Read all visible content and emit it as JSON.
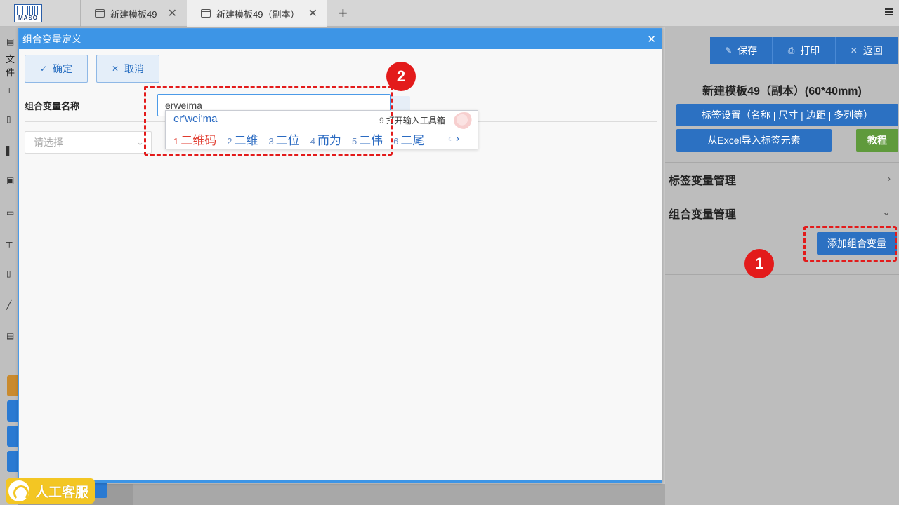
{
  "app": {
    "logo_text": "MASO",
    "tabs": [
      {
        "label": "新建模板49"
      },
      {
        "label": "新建模板49（副本）"
      }
    ],
    "add_tab_symbol": "+"
  },
  "left_sidebar": {
    "label_fragment": "文件"
  },
  "right_panel": {
    "buttons": {
      "save": "保存",
      "print": "打印",
      "back": "返回"
    },
    "template_title": "新建模板49（副本）(60*40mm)",
    "label_settings_button": "标签设置（名称 | 尺寸 | 边距 | 多列等）",
    "excel_import_button": "从Excel导入标签元素",
    "tutorial_button": "教程",
    "sections": [
      {
        "title": "标签变量管理",
        "expanded": false
      },
      {
        "title": "组合变量管理",
        "expanded": true
      }
    ],
    "add_combo_var_button": "添加组合变量"
  },
  "modal": {
    "title": "组合变量定义",
    "confirm_button": "确定",
    "cancel_button": "取消",
    "name_label": "组合变量名称",
    "name_input_value": "erweima",
    "select_placeholder": "请选择"
  },
  "ime": {
    "pinyin": "er'wei'ma",
    "toolbox": {
      "num": "9",
      "label": "打开输入工具箱"
    },
    "candidates": [
      {
        "num": "1",
        "text": "二维码",
        "selected": true
      },
      {
        "num": "2",
        "text": "二维",
        "selected": false
      },
      {
        "num": "3",
        "text": "二位",
        "selected": false
      },
      {
        "num": "4",
        "text": "而为",
        "selected": false
      },
      {
        "num": "5",
        "text": "二伟",
        "selected": false
      },
      {
        "num": "6",
        "text": "二尾",
        "selected": false
      }
    ]
  },
  "annotations": {
    "badge1": "1",
    "badge2": "2",
    "color": "#e31b1b"
  },
  "customer_service": {
    "label": "人工客服"
  },
  "colors": {
    "primary_blue": "#2c71c2",
    "modal_header": "#3d95e6",
    "tutorial_green": "#5f9a3c",
    "service_yellow": "#f3c623",
    "ime_selected": "#e03a2d"
  }
}
